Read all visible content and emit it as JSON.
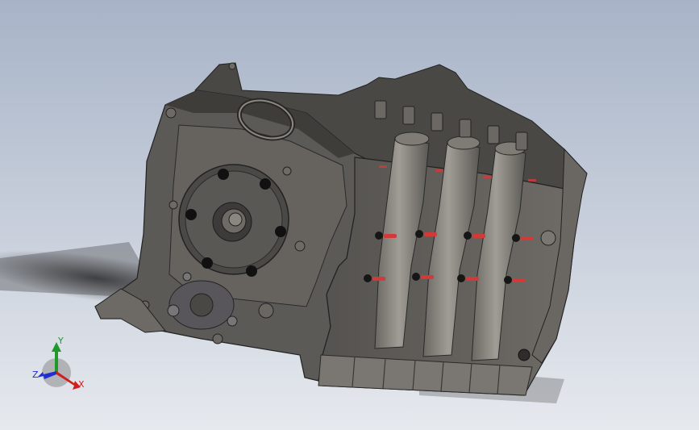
{
  "viewport": {
    "background_top": "#a7b3c7",
    "background_bottom": "#e6e9ee"
  },
  "model": {
    "body_color": "#5c5a57",
    "body_dark": "#3d3b39",
    "body_light": "#77746f",
    "pipe_color": "#8a8781",
    "bolt_color": "#161616",
    "spark_accent": "#d23a3a"
  },
  "triad": {
    "x_label": "X",
    "y_label": "Y",
    "z_label": "Z",
    "x_color": "#d01f1f",
    "y_color": "#1f9a2a",
    "z_color": "#1f2fd0"
  }
}
